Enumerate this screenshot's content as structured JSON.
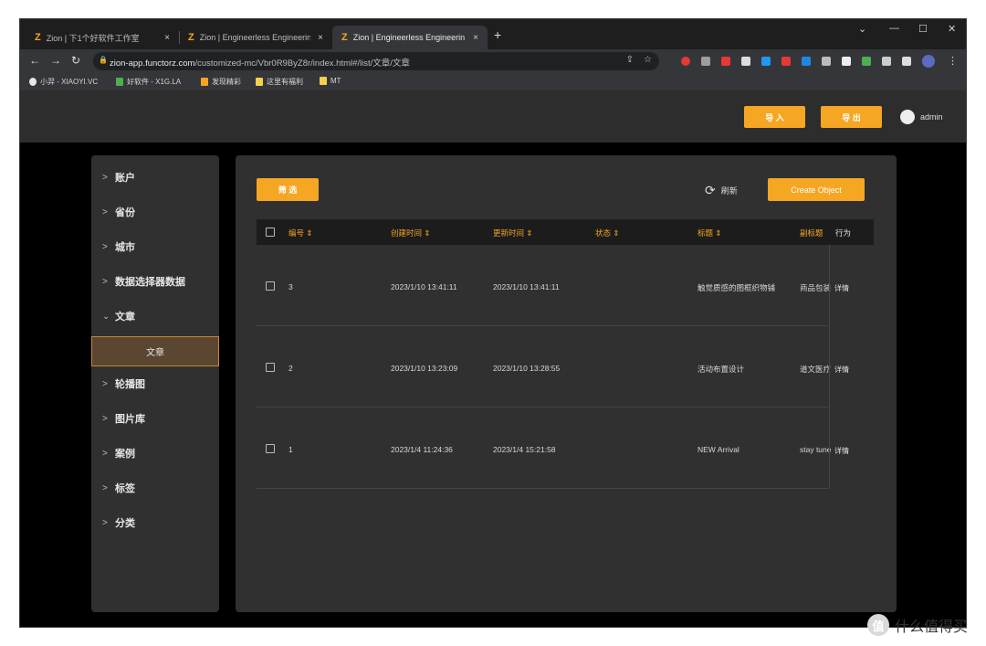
{
  "browser": {
    "tabs": [
      {
        "title": "Zion | 下1个好软件工作室",
        "close": "×"
      },
      {
        "title": "Zion | Engineerless Engineerin",
        "close": "×"
      },
      {
        "title": "Zion | Engineerless Engineerin",
        "close": "×"
      }
    ],
    "new_tab": "+",
    "url_host": "zion-app.functorz.com",
    "url_path": "/customized-mc/Vbr0R9ByZ8r/index.html#/list/文章/文章",
    "bookmarks": [
      {
        "label": "小羿 - XIAOYI.VC",
        "color": "#e8e8e8"
      },
      {
        "label": "好软件 - X1G.LA",
        "color": "#4caf50"
      },
      {
        "label": "发现精彩",
        "color": "#f5a623"
      },
      {
        "label": "这里有福利",
        "color": "#f5d04a"
      },
      {
        "label": "MT",
        "color": "#f5d04a"
      }
    ]
  },
  "header": {
    "import_label": "导 入",
    "export_label": "导 出",
    "user_name": "admin"
  },
  "sidebar": {
    "items": [
      {
        "label": "账户",
        "chevron": ">"
      },
      {
        "label": "省份",
        "chevron": ">"
      },
      {
        "label": "城市",
        "chevron": ">"
      },
      {
        "label": "数据选择器数据",
        "chevron": ">"
      },
      {
        "label": "文章",
        "chevron": "⌄"
      },
      {
        "label": "轮播图",
        "chevron": ">"
      },
      {
        "label": "图片库",
        "chevron": ">"
      },
      {
        "label": "案例",
        "chevron": ">"
      },
      {
        "label": "标签",
        "chevron": ">"
      },
      {
        "label": "分类",
        "chevron": ">"
      }
    ],
    "active_sub": "文章"
  },
  "toolbar": {
    "filter_label": "筛 选",
    "refresh_label": "刷新",
    "create_label": "Create Object"
  },
  "table": {
    "columns": [
      "编号 ⇕",
      "创建时间 ⇕",
      "更新时间 ⇕",
      "状态 ⇕",
      "标题 ⇕",
      "副标题",
      "行为"
    ],
    "rows": [
      {
        "id": "3",
        "created": "2023/1/10 13:41:11",
        "updated": "2023/1/10 13:41:11",
        "status": "",
        "title": "触觉质感的图框织物铺",
        "subtitle": "商品包装",
        "action": "详情"
      },
      {
        "id": "2",
        "created": "2023/1/10 13:23:09",
        "updated": "2023/1/10 13:28:55",
        "status": "",
        "title": "活动布置设计",
        "subtitle": "道文医疗",
        "action": "详情"
      },
      {
        "id": "1",
        "created": "2023/1/4 11:24:36",
        "updated": "2023/1/4 15:21:58",
        "status": "",
        "title": "NEW Arrival",
        "subtitle": "stay tuned",
        "action": "详情"
      }
    ]
  },
  "watermark": {
    "text": "什么值得买",
    "icon": "值"
  }
}
